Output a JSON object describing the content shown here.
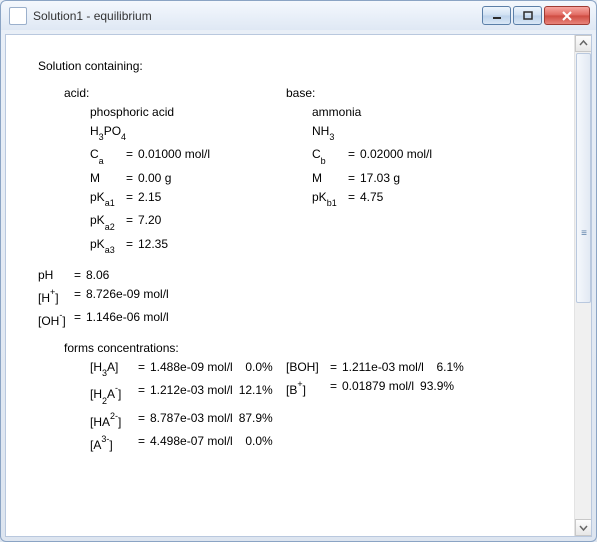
{
  "window": {
    "title": "Solution1 - equilibrium"
  },
  "heading": "Solution containing:",
  "acid": {
    "label": "acid:",
    "name": "phosphoric acid",
    "formula_h": "H",
    "formula_sub": "3",
    "formula_t": "PO",
    "formula_sub2": "4",
    "ca_label_a": "C",
    "ca_label_b": "a",
    "ca_eq": "=",
    "ca_val": "0.01000 mol/l",
    "m_label": "M",
    "m_eq": "=",
    "m_val": "0.00 g",
    "pka1_a": "pK",
    "pka1_b": "a1",
    "pka1_eq": "=",
    "pka1_val": "2.15",
    "pka2_a": "pK",
    "pka2_b": "a2",
    "pka2_eq": "=",
    "pka2_val": "7.20",
    "pka3_a": "pK",
    "pka3_b": "a3",
    "pka3_eq": "=",
    "pka3_val": "12.35"
  },
  "base": {
    "label": "base:",
    "name": "ammonia",
    "formula_h": "NH",
    "formula_sub": "3",
    "cb_label_a": "C",
    "cb_label_b": "b",
    "cb_eq": "=",
    "cb_val": "0.02000 mol/l",
    "m_label": "M",
    "m_eq": "=",
    "m_val": "17.03 g",
    "pkb1_a": "pK",
    "pkb1_b": "b1",
    "pkb1_eq": "=",
    "pkb1_val": "4.75"
  },
  "ph": {
    "label": "pH",
    "eq": "=",
    "val": "8.06"
  },
  "hp": {
    "pre": "[H",
    "sup": "+",
    "post": "]",
    "eq": "=",
    "val": "8.726e-09 mol/l"
  },
  "ohm": {
    "pre": "[OH",
    "sup": "-",
    "post": "]",
    "eq": "=",
    "val": "1.146e-06 mol/l"
  },
  "forms": {
    "label": "forms concentrations:",
    "a0": {
      "pre": "[H",
      "sub": "3",
      "mid": "A]",
      "eq": "=",
      "val": "1.488e-09 mol/l",
      "pct": "0.0%"
    },
    "a1": {
      "pre": "[H",
      "sub": "2",
      "mid": "A",
      "sup": "-",
      "post": "]",
      "eq": "=",
      "val": "1.212e-03 mol/l",
      "pct": "12.1%"
    },
    "a2": {
      "pre": "[HA",
      "sup": "2-",
      "post": "]",
      "eq": "=",
      "val": "8.787e-03 mol/l",
      "pct": "87.9%"
    },
    "a3": {
      "pre": "[A",
      "sup": "3-",
      "post": "]",
      "eq": "=",
      "val": "4.498e-07 mol/l",
      "pct": "0.0%"
    },
    "b0": {
      "pre": "[BOH]",
      "eq": "=",
      "val": "1.211e-03 mol/l",
      "pct": "6.1%"
    },
    "b1": {
      "pre": "[B",
      "sup": "+",
      "post": "]",
      "eq": "=",
      "val": "0.01879 mol/l",
      "pct": "93.9%"
    }
  }
}
